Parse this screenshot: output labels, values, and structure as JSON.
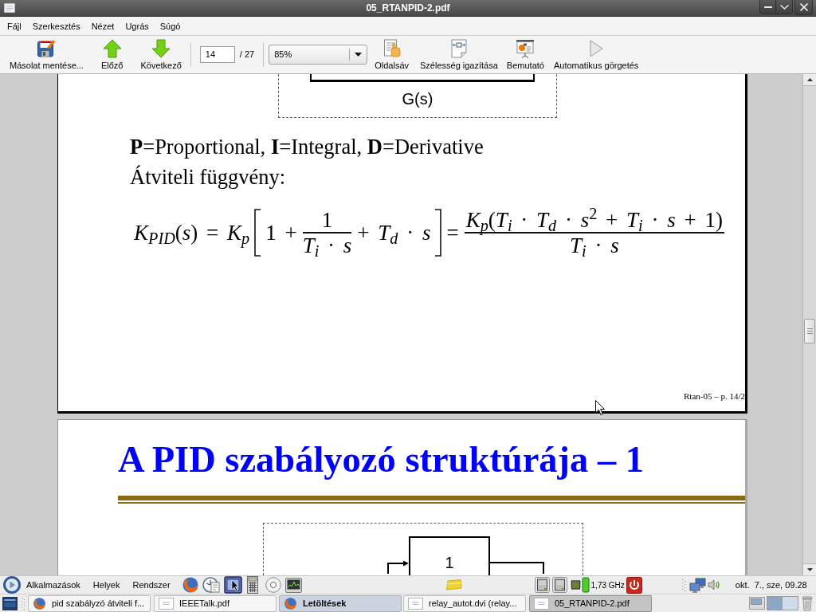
{
  "window": {
    "title": "05_RTANPID-2.pdf"
  },
  "menu": [
    {
      "label": "Fájl"
    },
    {
      "label": "Szerkesztés"
    },
    {
      "label": "Nézet"
    },
    {
      "label": "Ugrás"
    },
    {
      "label": "Súgó"
    }
  ],
  "toolbar": {
    "actions": [
      {
        "kind": "save",
        "label": "Másolat mentése..."
      },
      {
        "kind": "previous",
        "label": "Előző"
      },
      {
        "kind": "next",
        "label": "Következő"
      }
    ],
    "page_field": {
      "value": "14"
    },
    "page_count": "/ 27",
    "zoom": {
      "value": "85%"
    },
    "views": [
      {
        "kind": "sidebar",
        "label": "Oldalsáv"
      },
      {
        "kind": "fit_width",
        "label": "Szélesség igazítása"
      },
      {
        "kind": "presentation",
        "label": "Bemutató"
      },
      {
        "kind": "autoscroll",
        "label": "Automatikus görgetés"
      }
    ]
  },
  "pages": [
    {
      "kind": "equation",
      "diagram_label": "G(s)",
      "lines": [
        "**P**=Proportional, **I**=Integral, **D**=Derivative",
        "Átviteli függvény:"
      ],
      "formula": [
        {
          "kind": "text",
          "text": "*K*$_{PID}$(*s*) = *K*$_{p}$"
        },
        {
          "kind": "bracket_open"
        },
        {
          "kind": "text",
          "text": "1 +"
        },
        {
          "kind": "fraction",
          "numerator": "1",
          "denominator": "*T*$_{i}$ · *s*"
        },
        {
          "kind": "text",
          "text": "+ *T*$_{d}$ · *s*"
        },
        {
          "kind": "bracket_close"
        },
        {
          "kind": "text",
          "text": "="
        },
        {
          "kind": "fraction",
          "numerator": "*K*$_{p}$(*T*$_{i}$ · *T*$_{d}$ · *s*$^{2}$ + *T*$_{i}$ · *s* + 1)",
          "denominator": "*T*$_{i}$ · *s*"
        }
      ],
      "footer": "Rtan-05 – p. 14/2"
    },
    {
      "kind": "structure",
      "heading": "A PID szabályozó struktúrája – 1",
      "diagram_label": "1"
    }
  ],
  "top_panel": {
    "menus": [
      "Alkalmazások",
      "Helyek",
      "Rendszer"
    ],
    "cpu_frequency": "1,73 GHz",
    "clock": "okt.  7., sze, 09.28"
  },
  "bottom_panel": {
    "windows": [
      {
        "kind": "browser",
        "title": "pid szabályzó átviteli f...",
        "selected": false,
        "attention": false
      },
      {
        "kind": "document",
        "title": "IEEETalk.pdf",
        "selected": false,
        "attention": false
      },
      {
        "kind": "browser",
        "title": "Letöltések",
        "selected": false,
        "attention": true
      },
      {
        "kind": "document",
        "title": "relay_autot.dvi (relay...",
        "selected": false,
        "attention": false
      },
      {
        "kind": "document",
        "title": "05_RTANPID-2.pdf",
        "selected": true,
        "attention": false
      }
    ],
    "workspaces": [
      {
        "selected": true
      },
      {
        "selected": false
      }
    ]
  }
}
